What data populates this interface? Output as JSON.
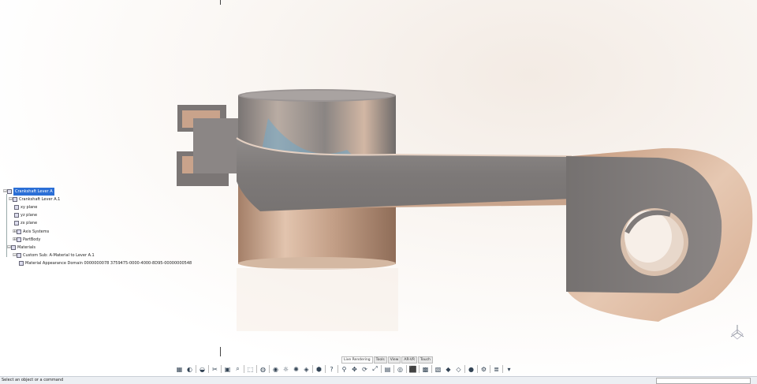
{
  "spec_tree": {
    "root": "Crankshaft Lever A",
    "part": "Crankshaft Lever A.1",
    "planes": [
      "xy plane",
      "yz plane",
      "zx plane"
    ],
    "axis_systems": "Axis Systems",
    "partbody": "PartBody",
    "materials": "Materials",
    "custom_sub": "Custom Sub: A-Material to Lever A.1",
    "appearance": "Material Appearance Domain 0000000078 3759475-0000-4000-8D95-00000000548"
  },
  "tabs": [
    {
      "label": "Live Rendering",
      "active": true
    },
    {
      "label": "Tools",
      "active": false
    },
    {
      "label": "View",
      "active": false
    },
    {
      "label": "AR-VR",
      "active": false
    },
    {
      "label": "Touch",
      "active": false
    }
  ],
  "toolbar_icons": [
    "display-mode-icon",
    "render-icon",
    "sep",
    "shading-icon",
    "sep",
    "cut-icon",
    "sep",
    "views-icon",
    "magnifier-icon",
    "sep",
    "standard-views-icon",
    "sep",
    "material-icon",
    "sep",
    "camera-icon",
    "ambience-icon",
    "light-icon",
    "mirror-icon",
    "sep",
    "environment-icon",
    "sep",
    "help-icon",
    "sep",
    "zoom-icon",
    "pan-icon",
    "rotate-icon",
    "fit-icon",
    "sep",
    "screenshot-icon",
    "sep",
    "turntable-icon",
    "sep",
    "cube-icon",
    "sep",
    "grid-icon",
    "sep",
    "photo-icon",
    "sticker-icon",
    "scene-icon",
    "sep",
    "shadow-icon",
    "sep",
    "settings-icon",
    "sep",
    "layers-icon",
    "sep",
    "more-icon"
  ],
  "status": {
    "message": "Select an object or a command",
    "field_value": ""
  }
}
